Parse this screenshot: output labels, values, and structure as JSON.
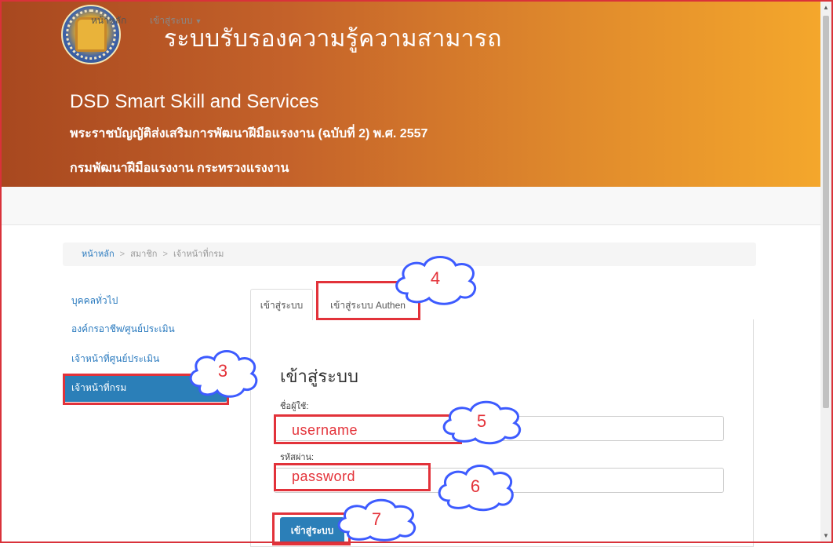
{
  "header": {
    "title_th": "ระบบรับรองความรู้ความสามารถ",
    "title_en": "DSD Smart Skill and Services",
    "act": "พระราชบัญญัติส่งเสริมการพัฒนาฝีมือแรงงาน (ฉบับที่ 2) พ.ศ. 2557",
    "department": "กรมพัฒนาฝีมือแรงงาน กระทรวงแรงงาน",
    "logo": "dsd-seal-logo"
  },
  "nav": {
    "home": "หน้าหลัก",
    "login": "เข้าสู่ระบบ"
  },
  "breadcrumb": {
    "home": "หน้าหลัก",
    "separator": ">",
    "level2": "สมาชิก",
    "level3": "เจ้าหน้าที่กรม"
  },
  "sidebar": {
    "items": [
      {
        "label": "บุคคลทั่วไป"
      },
      {
        "label": "องค์กรอาชีพ/ศูนย์ประเมิน"
      },
      {
        "label": "เจ้าหน้าที่ศูนย์ประเมิน"
      },
      {
        "label": "เจ้าหน้าที่กรม"
      }
    ]
  },
  "tabs": [
    {
      "label": "เข้าสู่ระบบ"
    },
    {
      "label": "เข้าสู่ระบบ Authen"
    }
  ],
  "form": {
    "title": "เข้าสู่ระบบ",
    "username_label": "ชื่อผู้ใช้:",
    "username_value": "username",
    "password_label": "รหัสผ่าน:",
    "password_value": "password",
    "submit_label": "เข้าสู่ระบบ"
  },
  "callouts": [
    "3",
    "4",
    "5",
    "6",
    "7"
  ],
  "colors": {
    "banner_start": "#a8481f",
    "banner_end": "#f4a72c",
    "primary": "#2b7fb8",
    "annotation": "#e2323a",
    "cloud_outline": "#3d5bff"
  }
}
